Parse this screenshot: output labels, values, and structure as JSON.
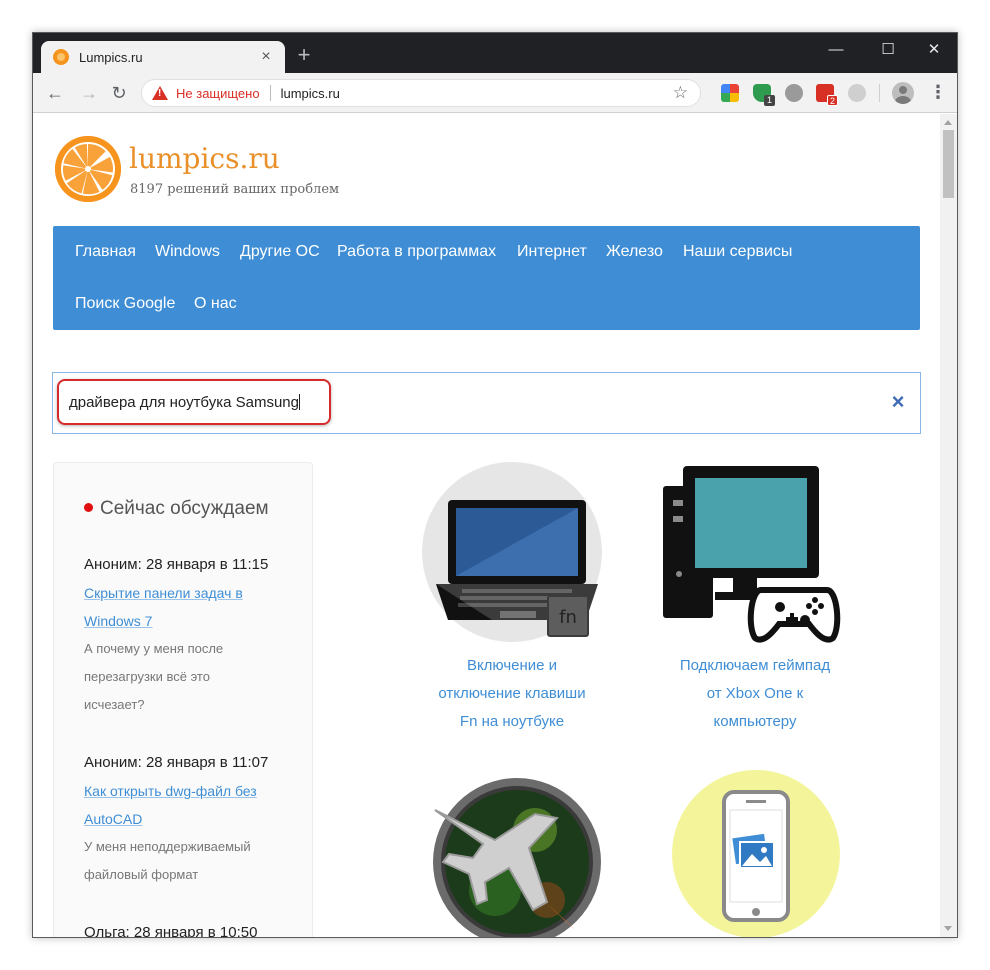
{
  "browser": {
    "tab_title": "Lumpics.ru",
    "tab_close": "×",
    "new_tab": "+",
    "controls": {
      "minimize": "—",
      "maximize": "☐",
      "close": "✕"
    },
    "security_text": "Не защищено",
    "url": "lumpics.ru",
    "extensions": [
      {
        "name": "extension-1"
      },
      {
        "name": "extension-shield",
        "badge": "1"
      },
      {
        "name": "extension-globe"
      },
      {
        "name": "extension-mail",
        "badge": "2"
      },
      {
        "name": "extension-cloud"
      }
    ]
  },
  "site": {
    "name": "lumpics.ru",
    "tagline": "8197 решений ваших проблем"
  },
  "nav": {
    "items": [
      "Главная",
      "Windows",
      "Другие ОС",
      "Работа в программах",
      "Интернет",
      "Железо",
      "Наши сервисы",
      "Поиск Google",
      "О нас"
    ]
  },
  "search": {
    "value": "драйвера для ноутбука Samsung",
    "clear": "×"
  },
  "sidebar": {
    "title": "Сейчас обсуждаем",
    "comments": [
      {
        "author": "Аноним: 28 января в 11:15",
        "link_line1": "Скрытие панели задач в",
        "link_line2": "Windows 7",
        "text_line1": "А почему у меня после",
        "text_line2": "перезагрузки всё это",
        "text_line3": "исчезает?"
      },
      {
        "author": "Аноним: 28 января в 11:07",
        "link_line1": "Как открыть dwg-файл без",
        "link_line2": "AutoCAD",
        "text_line1": "У меня неподдерживаемый",
        "text_line2": "файловый формат"
      },
      {
        "author": "Ольга: 28 января в 10:50"
      }
    ]
  },
  "articles": [
    {
      "line1": "Включение и",
      "line2": "отключение клавиши",
      "line3": "Fn на ноутбуке",
      "key_label": "fn"
    },
    {
      "line1": "Подключаем геймпад",
      "line2": "от Xbox One к",
      "line3": "компьютеру"
    }
  ],
  "colors": {
    "accent": "#3f8ed5",
    "brand_orange": "#f7941d",
    "highlight_red": "#d62b2b"
  }
}
